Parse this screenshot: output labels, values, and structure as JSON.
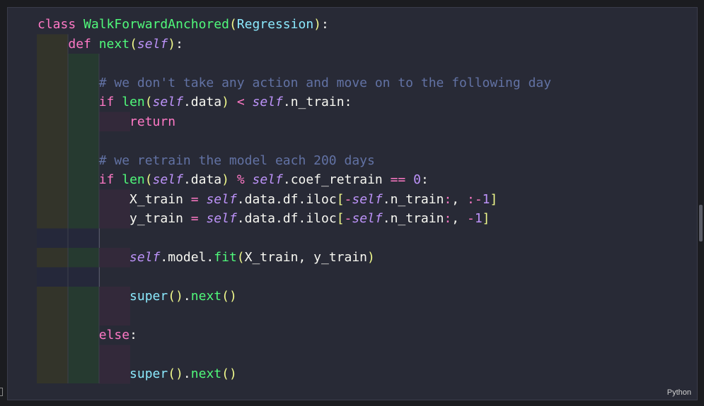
{
  "editor": {
    "language": "Python",
    "lines": [
      {
        "indent": 0,
        "tokens": [
          {
            "t": "class",
            "c": "kw"
          },
          {
            "t": " "
          },
          {
            "t": "WalkForwardAnchored",
            "c": "fn"
          },
          {
            "t": "(",
            "c": "br"
          },
          {
            "t": "Regression",
            "c": "cls"
          },
          {
            "t": ")",
            "c": "br"
          },
          {
            "t": ":"
          }
        ]
      },
      {
        "indent": 1,
        "tokens": [
          {
            "t": "def",
            "c": "kw"
          },
          {
            "t": " "
          },
          {
            "t": "next",
            "c": "fn"
          },
          {
            "t": "(",
            "c": "br"
          },
          {
            "t": "self",
            "c": "self"
          },
          {
            "t": ")",
            "c": "br"
          },
          {
            "t": ":"
          }
        ]
      },
      {
        "indent": 0,
        "tokens": []
      },
      {
        "indent": 2,
        "tokens": [
          {
            "t": "# we don't take any action and move on to the following day",
            "c": "cm"
          }
        ]
      },
      {
        "indent": 2,
        "tokens": [
          {
            "t": "if",
            "c": "kw"
          },
          {
            "t": " "
          },
          {
            "t": "len",
            "c": "fn"
          },
          {
            "t": "(",
            "c": "br"
          },
          {
            "t": "self",
            "c": "self"
          },
          {
            "t": ".data"
          },
          {
            "t": ")",
            "c": "br"
          },
          {
            "t": " "
          },
          {
            "t": "<",
            "c": "op"
          },
          {
            "t": " "
          },
          {
            "t": "self",
            "c": "self"
          },
          {
            "t": ".n_train:"
          }
        ]
      },
      {
        "indent": 3,
        "tokens": [
          {
            "t": "return",
            "c": "kw"
          }
        ]
      },
      {
        "indent": 0,
        "tokens": []
      },
      {
        "indent": 2,
        "tokens": [
          {
            "t": "# we retrain the model each 200 days",
            "c": "cm"
          }
        ]
      },
      {
        "indent": 2,
        "tokens": [
          {
            "t": "if",
            "c": "kw"
          },
          {
            "t": " "
          },
          {
            "t": "len",
            "c": "fn"
          },
          {
            "t": "(",
            "c": "br"
          },
          {
            "t": "self",
            "c": "self"
          },
          {
            "t": ".data"
          },
          {
            "t": ")",
            "c": "br"
          },
          {
            "t": " "
          },
          {
            "t": "%",
            "c": "op"
          },
          {
            "t": " "
          },
          {
            "t": "self",
            "c": "self"
          },
          {
            "t": ".coef_retrain "
          },
          {
            "t": "==",
            "c": "op"
          },
          {
            "t": " "
          },
          {
            "t": "0",
            "c": "num"
          },
          {
            "t": ":"
          }
        ]
      },
      {
        "indent": 3,
        "tokens": [
          {
            "t": "X_train "
          },
          {
            "t": "=",
            "c": "op"
          },
          {
            "t": " "
          },
          {
            "t": "self",
            "c": "self"
          },
          {
            "t": ".data.df.iloc"
          },
          {
            "t": "[",
            "c": "br"
          },
          {
            "t": "-",
            "c": "op"
          },
          {
            "t": "self",
            "c": "self"
          },
          {
            "t": ".n_train"
          },
          {
            "t": ":",
            "c": "op"
          },
          {
            "t": ", "
          },
          {
            "t": ":",
            "c": "op"
          },
          {
            "t": "-",
            "c": "op"
          },
          {
            "t": "1",
            "c": "num"
          },
          {
            "t": "]",
            "c": "br"
          }
        ]
      },
      {
        "indent": 3,
        "tokens": [
          {
            "t": "y_train "
          },
          {
            "t": "=",
            "c": "op"
          },
          {
            "t": " "
          },
          {
            "t": "self",
            "c": "self"
          },
          {
            "t": ".data.df.iloc"
          },
          {
            "t": "[",
            "c": "br"
          },
          {
            "t": "-",
            "c": "op"
          },
          {
            "t": "self",
            "c": "self"
          },
          {
            "t": ".n_train"
          },
          {
            "t": ":",
            "c": "op"
          },
          {
            "t": ", "
          },
          {
            "t": "-",
            "c": "op"
          },
          {
            "t": "1",
            "c": "num"
          },
          {
            "t": "]",
            "c": "br"
          }
        ]
      },
      {
        "indent": 0,
        "tokens": []
      },
      {
        "indent": 3,
        "tokens": [
          {
            "t": "self",
            "c": "self"
          },
          {
            "t": ".model."
          },
          {
            "t": "fit",
            "c": "fn"
          },
          {
            "t": "(",
            "c": "br"
          },
          {
            "t": "X_train, y_train"
          },
          {
            "t": ")",
            "c": "br"
          }
        ]
      },
      {
        "indent": 0,
        "tokens": []
      },
      {
        "indent": 3,
        "tokens": [
          {
            "t": "super",
            "c": "cls"
          },
          {
            "t": "()",
            "c": "br"
          },
          {
            "t": "."
          },
          {
            "t": "next",
            "c": "fn"
          },
          {
            "t": "()",
            "c": "br"
          }
        ]
      },
      {
        "indent": 0,
        "tokens": []
      },
      {
        "indent": 2,
        "tokens": [
          {
            "t": "else",
            "c": "kw"
          },
          {
            "t": ":"
          }
        ]
      },
      {
        "indent": 0,
        "tokens": []
      },
      {
        "indent": 3,
        "tokens": [
          {
            "t": "super",
            "c": "cls"
          },
          {
            "t": "()",
            "c": "br"
          },
          {
            "t": "."
          },
          {
            "t": "next",
            "c": "fn"
          },
          {
            "t": "()",
            "c": "br"
          }
        ]
      }
    ]
  }
}
